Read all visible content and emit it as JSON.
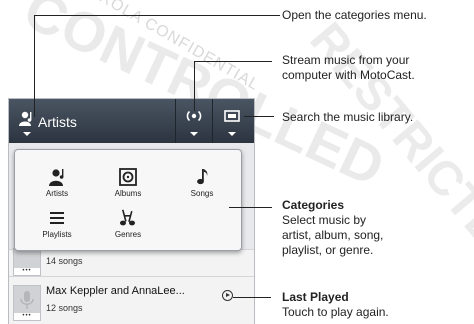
{
  "watermark": {
    "line1": "MOTOROLA CONFIDENTIAL",
    "line2": "CONTROLLED",
    "line3": "Confidential",
    "line4": "RESTRICTED"
  },
  "app": {
    "topbar": {
      "category_label": "Artists"
    },
    "categories_menu": {
      "items": [
        {
          "label": "Artists",
          "icon": "artist-icon"
        },
        {
          "label": "Albums",
          "icon": "album-icon"
        },
        {
          "label": "Songs",
          "icon": "music-note-icon"
        },
        {
          "label": "Playlists",
          "icon": "playlist-icon"
        },
        {
          "label": "Genres",
          "icon": "genres-icon"
        }
      ]
    },
    "list": {
      "rows": [
        {
          "title": "",
          "subtitle": "14 songs"
        },
        {
          "title": "Max Keppler and AnnaLee...",
          "subtitle": "12 songs"
        }
      ]
    }
  },
  "callouts": {
    "open_categories": "Open the categories menu.",
    "stream_line1": "Stream music from your",
    "stream_line2": "computer with MotoCast.",
    "search": "Search the music library.",
    "categories_title": "Categories",
    "categories_line1": "Select music by",
    "categories_line2": "artist, album, song,",
    "categories_line3": "playlist, or genre.",
    "last_played_title": "Last Played",
    "last_played_line1": "Touch to play again."
  }
}
